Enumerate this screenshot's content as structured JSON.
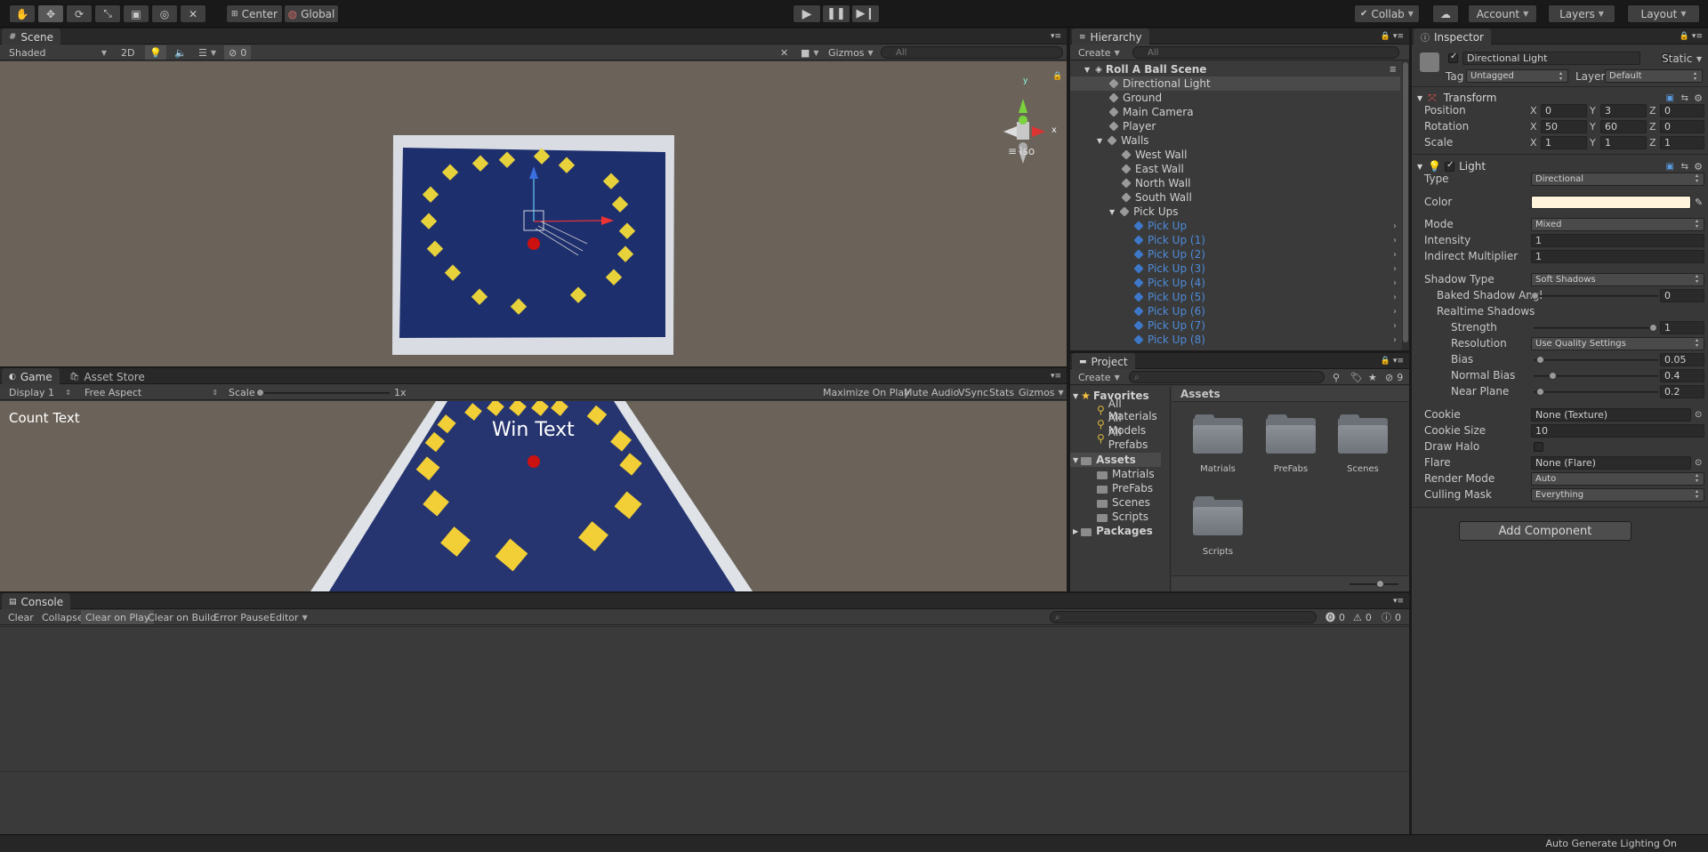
{
  "toolbar": {
    "pivot": "Center",
    "space": "Global",
    "collab": "Collab",
    "account": "Account",
    "layers": "Layers",
    "layout": "Layout"
  },
  "scene": {
    "tab": "Scene",
    "shading": "Shaded",
    "mode_2d": "2D",
    "hidden_count": "0",
    "gizmos": "Gizmos",
    "search": "All",
    "iso": "Iso",
    "axis_x": "x",
    "axis_y": "y"
  },
  "game": {
    "tab": "Game",
    "tab2": "Asset Store",
    "display": "Display 1",
    "aspect": "Free Aspect",
    "scale_label": "Scale",
    "scale_value": "1x",
    "maximize": "Maximize On Play",
    "mute": "Mute Audio",
    "vsync": "VSync",
    "stats": "Stats",
    "gizmos": "Gizmos",
    "count_text": "Count Text",
    "win_text": "Win Text"
  },
  "console": {
    "tab": "Console",
    "clear": "Clear",
    "collapse": "Collapse",
    "clear_play": "Clear on Play",
    "clear_build": "Clear on Build",
    "error_pause": "Error Pause",
    "editor": "Editor",
    "err": "0",
    "warn": "0",
    "info": "0"
  },
  "hierarchy": {
    "tab": "Hierarchy",
    "create": "Create",
    "search": "All",
    "scene": "Roll A Ball Scene",
    "items": [
      {
        "label": "Directional Light"
      },
      {
        "label": "Ground"
      },
      {
        "label": "Main Camera"
      },
      {
        "label": "Player"
      },
      {
        "label": "Walls"
      },
      {
        "label": "West Wall"
      },
      {
        "label": "East Wall"
      },
      {
        "label": "North Wall"
      },
      {
        "label": "South Wall"
      },
      {
        "label": "Pick Ups"
      },
      {
        "label": "Pick Up"
      },
      {
        "label": "Pick Up (1)"
      },
      {
        "label": "Pick Up (2)"
      },
      {
        "label": "Pick Up (3)"
      },
      {
        "label": "Pick Up (4)"
      },
      {
        "label": "Pick Up (5)"
      },
      {
        "label": "Pick Up (6)"
      },
      {
        "label": "Pick Up (7)"
      },
      {
        "label": "Pick Up (8)"
      }
    ]
  },
  "project": {
    "tab": "Project",
    "create": "Create",
    "count": "9",
    "favorites": "Favorites",
    "fav_items": [
      {
        "label": "All Materials"
      },
      {
        "label": "All Models"
      },
      {
        "label": "All Prefabs"
      }
    ],
    "assets": "Assets",
    "tree": [
      {
        "label": "Matrials"
      },
      {
        "label": "PreFabs"
      },
      {
        "label": "Scenes"
      },
      {
        "label": "Scripts"
      }
    ],
    "packages": "Packages",
    "grid_title": "Assets",
    "grid": [
      {
        "label": "Matrials"
      },
      {
        "label": "PreFabs"
      },
      {
        "label": "Scenes"
      },
      {
        "label": "Scripts"
      }
    ]
  },
  "inspector": {
    "tab": "Inspector",
    "name": "Directional Light",
    "static": "Static",
    "tag_label": "Tag",
    "tag": "Untagged",
    "layer_label": "Layer",
    "layer": "Default",
    "transform": "Transform",
    "position": "Position",
    "rotation": "Rotation",
    "scale": "Scale",
    "pos": {
      "x": "0",
      "y": "3",
      "z": "0"
    },
    "rot": {
      "x": "50",
      "y": "60",
      "z": "0"
    },
    "scl": {
      "x": "1",
      "y": "1",
      "z": "1"
    },
    "ax": {
      "x": "X",
      "y": "Y",
      "z": "Z"
    },
    "light": "Light",
    "type_label": "Type",
    "type": "Directional",
    "color_label": "Color",
    "light_color": "#fff3dc",
    "mode_label": "Mode",
    "mode": "Mixed",
    "intensity_label": "Intensity",
    "intensity": "1",
    "indirect_label": "Indirect Multiplier",
    "indirect": "1",
    "shadow_label": "Shadow Type",
    "shadow": "Soft Shadows",
    "baked_label": "Baked Shadow Angl",
    "baked": "0",
    "realtime_label": "Realtime Shadows",
    "strength_label": "Strength",
    "strength": "1",
    "resolution_label": "Resolution",
    "resolution": "Use Quality Settings",
    "bias_label": "Bias",
    "bias": "0.05",
    "normal_bias_label": "Normal Bias",
    "normal_bias": "0.4",
    "near_label": "Near Plane",
    "near": "0.2",
    "cookie_label": "Cookie",
    "cookie": "None (Texture)",
    "cookie_size_label": "Cookie Size",
    "cookie_size": "10",
    "halo_label": "Draw Halo",
    "flare_label": "Flare",
    "flare": "None (Flare)",
    "render_label": "Render Mode",
    "render": "Auto",
    "culling_label": "Culling Mask",
    "culling": "Everything",
    "add_component": "Add Component"
  },
  "status": {
    "text": "Auto Generate Lighting On"
  }
}
